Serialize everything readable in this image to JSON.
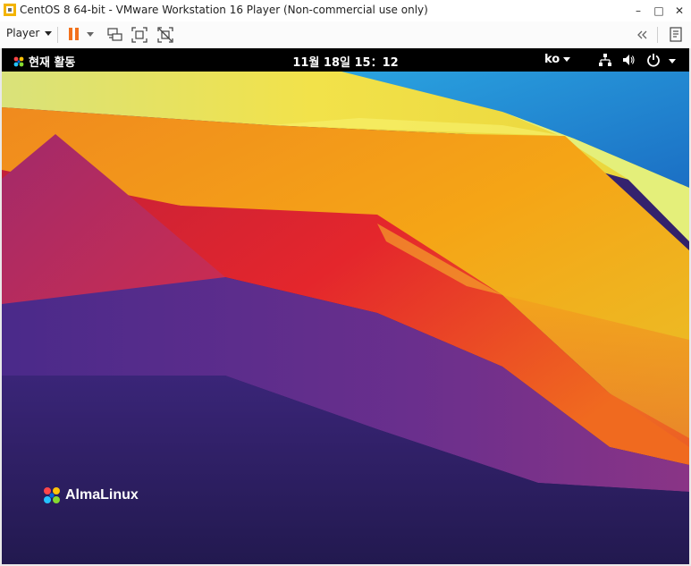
{
  "window": {
    "title": "CentOS 8 64-bit - VMware Workstation 16 Player (Non-commercial use only)",
    "minimize": "–",
    "maximize": "□",
    "close": "✕"
  },
  "toolbar": {
    "player_label": "Player",
    "accent": "#f2711c"
  },
  "gnome": {
    "activities": "현재 활동",
    "clock": "11월 18일  15：12",
    "language": "ko"
  },
  "desktop": {
    "brand": "AlmaLinux"
  }
}
